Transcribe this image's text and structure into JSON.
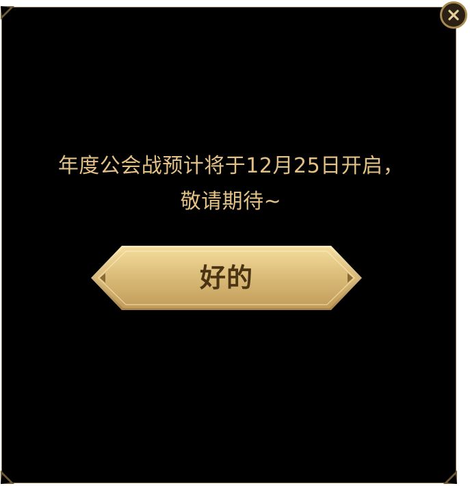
{
  "dialog": {
    "message_line1": "年度公会战预计将于12月25日开启，",
    "message_line2": "敬请期待~",
    "ok_label": "好的",
    "close_icon": "close-icon"
  },
  "colors": {
    "background": "#000000",
    "border": "#8c7548",
    "text": "#e3c184",
    "button_gold_light": "#f3dc9c",
    "button_gold_dark": "#c19c5a",
    "button_text": "#4a3414"
  }
}
